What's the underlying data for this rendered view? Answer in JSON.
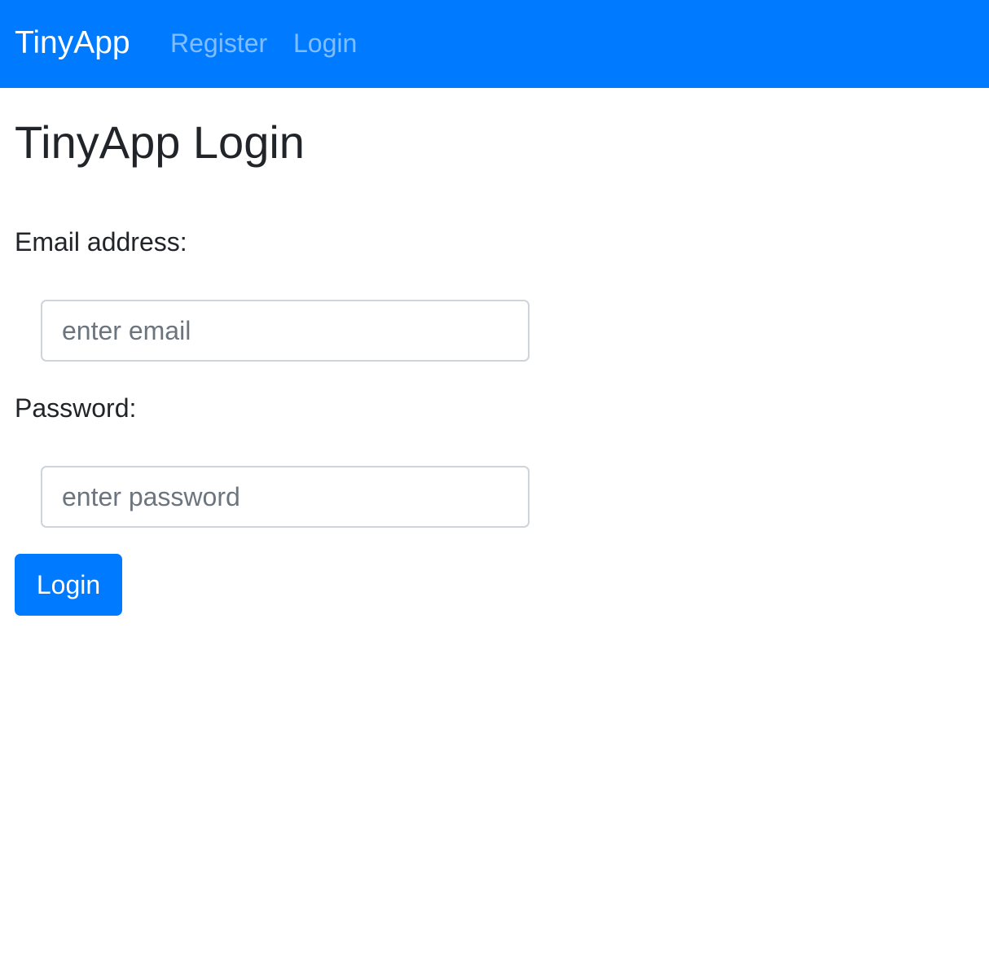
{
  "navbar": {
    "brand": "TinyApp",
    "links": [
      {
        "label": "Register"
      },
      {
        "label": "Login"
      }
    ],
    "background_color": "#007bff"
  },
  "page": {
    "title": "TinyApp Login"
  },
  "form": {
    "email": {
      "label": "Email address:",
      "value": "",
      "placeholder": "enter email"
    },
    "password": {
      "label": "Password:",
      "value": "",
      "placeholder": "enter password"
    },
    "submit_label": "Login",
    "submit_color": "#007bff"
  }
}
